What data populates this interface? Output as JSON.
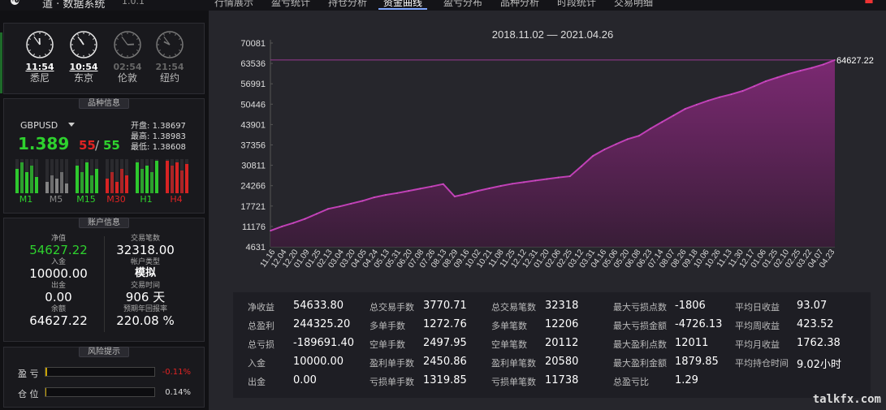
{
  "app": {
    "logo": "☯",
    "title": "道 · 数据系统",
    "version": "1.0.1"
  },
  "tabs": [
    {
      "label": "行情展示",
      "active": false
    },
    {
      "label": "盈亏统计",
      "active": false
    },
    {
      "label": "持仓分析",
      "active": false
    },
    {
      "label": "资金曲线",
      "active": true
    },
    {
      "label": "盈亏分布",
      "active": false
    },
    {
      "label": "品种分析",
      "active": false
    },
    {
      "label": "时段统计",
      "active": false
    },
    {
      "label": "交易明细",
      "active": false
    }
  ],
  "clocks": [
    {
      "time": "11:54",
      "city": "悉尼",
      "active": true,
      "hour": 11,
      "minute": 54
    },
    {
      "time": "10:54",
      "city": "东京",
      "active": true,
      "hour": 10,
      "minute": 54
    },
    {
      "time": "02:54",
      "city": "伦敦",
      "active": false,
      "hour": 2,
      "minute": 54
    },
    {
      "time": "21:54",
      "city": "纽约",
      "active": false,
      "hour": 21,
      "minute": 54
    }
  ],
  "symbol_panel": {
    "title": "品种信息",
    "symbol": "GBPUSD",
    "price": "1.389",
    "spread_a": "55",
    "spread_sep": "/",
    "spread_b": "55",
    "open_label": "开盘:",
    "open": "1.38697",
    "high_label": "最高:",
    "high": "1.38983",
    "low_label": "最低:",
    "low": "1.38608",
    "timeframes": [
      {
        "label": "M1",
        "color": "#2ed12e"
      },
      {
        "label": "M5",
        "color": "#888888"
      },
      {
        "label": "M15",
        "color": "#2ed12e"
      },
      {
        "label": "M30",
        "color": "#e02323"
      },
      {
        "label": "H1",
        "color": "#2ed12e"
      },
      {
        "label": "H4",
        "color": "#e02323"
      }
    ]
  },
  "account_panel": {
    "title": "账户信息",
    "equity_label": "净值",
    "equity": "54627.22",
    "trades_label": "交易笔数",
    "trades": "32318.00",
    "deposit_label": "入金",
    "deposit": "10000.00",
    "acct_type_label": "帐户类型",
    "acct_type": "模拟",
    "withdraw_label": "出金",
    "withdraw": "0.00",
    "duration_label": "交易时间",
    "duration": "906 天",
    "balance_label": "余额",
    "balance": "64627.22",
    "annual_label": "预期年回报率",
    "annual": "220.08 %"
  },
  "risk_panel": {
    "title": "风险提示",
    "pl_label": "盈 亏",
    "pl_value": "-0.11%",
    "pl_fraction": 0.011,
    "pos_label": "仓 位",
    "pos_value": "0.14%",
    "pos_fraction": 0.0014
  },
  "chart_data": {
    "type": "area",
    "title": "2018.11.02 — 2021.04.26",
    "y_ticks": [
      "70081",
      "63536",
      "56991",
      "50446",
      "43901",
      "37356",
      "30811",
      "24266",
      "17721",
      "11176",
      "4631"
    ],
    "ylim": [
      4631,
      70081
    ],
    "last_value": 64627.22,
    "last_value_label": "64627.22",
    "x_tick_labels": [
      "11.16",
      "12.04",
      "12.20",
      "01.09",
      "01.25",
      "02.13",
      "03.04",
      "03.20",
      "04.05",
      "04.24",
      "05.13",
      "05.31",
      "06.20",
      "07.08",
      "07.26",
      "08.13",
      "08.29",
      "09.16",
      "10.02",
      "10.21",
      "11.08",
      "11.25",
      "12.12",
      "12.31",
      "01.20",
      "02.06",
      "02.25",
      "03.12",
      "03.31",
      "04.16",
      "05.06",
      "05.20",
      "06.08",
      "06.23",
      "07.14",
      "08.07",
      "08.26",
      "09.18",
      "10.06",
      "10.26",
      "11.13",
      "11.30",
      "12.17",
      "01.06",
      "01.25",
      "02.10",
      "02.25",
      "03.22",
      "04.07",
      "04.23"
    ],
    "series": [
      {
        "values": [
          9800,
          11176,
          12300,
          13600,
          15200,
          16800,
          17600,
          18500,
          19400,
          20500,
          21300,
          21900,
          22600,
          23300,
          24000,
          24800,
          20800,
          21600,
          22600,
          23400,
          24200,
          24900,
          25400,
          25900,
          26400,
          26900,
          27300,
          30500,
          33800,
          35900,
          37600,
          39200,
          40300,
          42600,
          44700,
          46800,
          48900,
          50300,
          51600,
          52700,
          53600,
          54700,
          56200,
          57800,
          59000,
          60200,
          61200,
          62100,
          63200,
          64627.22
        ]
      }
    ]
  },
  "stats": [
    {
      "label": "净收益",
      "value": "54633.80",
      "col": 0,
      "row": 0
    },
    {
      "label": "总盈利",
      "value": "244325.20",
      "col": 0,
      "row": 1
    },
    {
      "label": "总亏损",
      "value": "-189691.40",
      "col": 0,
      "row": 2
    },
    {
      "label": "入金",
      "value": "10000.00",
      "col": 0,
      "row": 3
    },
    {
      "label": "出金",
      "value": "0.00",
      "col": 0,
      "row": 4
    },
    {
      "label": "总交易手数",
      "value": "3770.71",
      "col": 1,
      "row": 0
    },
    {
      "label": "多单手数",
      "value": "1272.76",
      "col": 1,
      "row": 1
    },
    {
      "label": "空单手数",
      "value": "2497.95",
      "col": 1,
      "row": 2
    },
    {
      "label": "盈利单手数",
      "value": "2450.86",
      "col": 1,
      "row": 3
    },
    {
      "label": "亏损单手数",
      "value": "1319.85",
      "col": 1,
      "row": 4
    },
    {
      "label": "总交易笔数",
      "value": "32318",
      "col": 2,
      "row": 0
    },
    {
      "label": "多单笔数",
      "value": "12206",
      "col": 2,
      "row": 1
    },
    {
      "label": "空单笔数",
      "value": "20112",
      "col": 2,
      "row": 2
    },
    {
      "label": "盈利单笔数",
      "value": "20580",
      "col": 2,
      "row": 3
    },
    {
      "label": "亏损单笔数",
      "value": "11738",
      "col": 2,
      "row": 4
    },
    {
      "label": "最大亏损点数",
      "value": "-1806",
      "col": 3,
      "row": 0
    },
    {
      "label": "最大亏损金额",
      "value": "-4726.13",
      "col": 3,
      "row": 1
    },
    {
      "label": "最大盈利点数",
      "value": "12011",
      "col": 3,
      "row": 2
    },
    {
      "label": "最大盈利金额",
      "value": "1879.85",
      "col": 3,
      "row": 3
    },
    {
      "label": "总盈亏比",
      "value": "1.29",
      "col": 3,
      "row": 4
    },
    {
      "label": "平均日收益",
      "value": "93.07",
      "col": 4,
      "row": 0
    },
    {
      "label": "平均周收益",
      "value": "423.52",
      "col": 4,
      "row": 1
    },
    {
      "label": "平均月收益",
      "value": "1762.38",
      "col": 4,
      "row": 2
    },
    {
      "label": "平均持仓时间",
      "value": "9.02小时",
      "col": 4,
      "row": 3
    }
  ],
  "watermark": "talkfx.com",
  "colors": {
    "accent": "#b03aa8",
    "green": "#2ed12e",
    "red": "#e02323"
  }
}
